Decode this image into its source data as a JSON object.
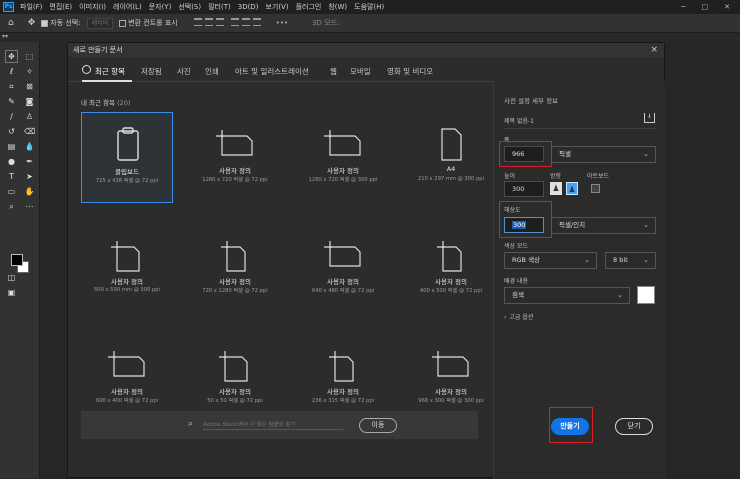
{
  "menubar": {
    "logo": "Ps",
    "items": [
      "파일(F)",
      "편집(E)",
      "이미지(I)",
      "레이어(L)",
      "문자(Y)",
      "선택(S)",
      "필터(T)",
      "3D(D)",
      "보기(V)",
      "플러그인",
      "창(W)",
      "도움말(H)"
    ]
  },
  "options": {
    "auto_select": "자동 선택:",
    "layer_value": "레이어",
    "transform": "변환 컨트롤 표시",
    "mode_3d": "3D 모드:"
  },
  "doc_strip": {
    "text": "▾▾"
  },
  "dialog": {
    "title": "새로 만들기 문서",
    "close": "×",
    "tabs": [
      "최근 항목",
      "저장됨",
      "사진",
      "인쇄",
      "아트 및 일러스트레이션",
      "웹",
      "모바일",
      "영화 및 비디오"
    ],
    "recent_label": "내 최근 항목",
    "recent_count": "(20)",
    "presets": [
      {
        "name": "클립보드",
        "size": "725 x 438 픽셀 @ 72 ppi",
        "icon": "clipboard-icon",
        "selected": true
      },
      {
        "name": "사용자 정의",
        "size": "1280 x 720 픽셀 @ 72 ppi",
        "icon": "custom-landscape-icon"
      },
      {
        "name": "사용자 정의",
        "size": "1280 x 720 픽셀 @ 300 ppi",
        "icon": "custom-landscape-icon"
      },
      {
        "name": "A4",
        "size": "210 x 297 mm @ 300 ppi",
        "icon": "document-icon"
      },
      {
        "name": "사용자 정의",
        "size": "500 x 500 mm @ 300 ppi",
        "icon": "custom-square-icon"
      },
      {
        "name": "사용자 정의",
        "size": "720 x 1280 픽셀 @ 72 ppi",
        "icon": "custom-portrait-icon"
      },
      {
        "name": "사용자 정의",
        "size": "640 x 480 픽셀 @ 72 ppi",
        "icon": "custom-landscape-icon"
      },
      {
        "name": "사용자 정의",
        "size": "400 x 500 픽셀 @ 72 ppi",
        "icon": "custom-portrait-icon"
      },
      {
        "name": "사용자 정의",
        "size": "600 x 400 픽셀 @ 72 ppi",
        "icon": "custom-landscape-icon"
      },
      {
        "name": "사용자 정의",
        "size": "50 x 50 픽셀 @ 72 ppi",
        "icon": "custom-square-icon"
      },
      {
        "name": "사용자 정의",
        "size": "236 x 315 픽셀 @ 72 ppi",
        "icon": "custom-portrait-icon"
      },
      {
        "name": "사용자 정의",
        "size": "966 x 300 픽셀 @ 300 ppi",
        "icon": "custom-landscape-icon"
      }
    ],
    "search": {
      "placeholder": "Adobe Stock에서 더 많은 템플릿 찾기",
      "go_label": "이동"
    },
    "details": {
      "section_title": "사전 설정 세부 정보",
      "doc_name": "제목 없음-1",
      "width_label": "폭",
      "width_value": "966",
      "width_unit": "픽셀",
      "height_label": "높이",
      "height_value": "300",
      "orientation_label": "방향",
      "artboard_label": "아트보드",
      "resolution_label": "해상도",
      "resolution_value": "300",
      "resolution_unit": "픽셀/인치",
      "color_mode_label": "색상 모드",
      "color_mode_value": "RGB 색상",
      "bit_depth": "8 bit",
      "background_label": "배경 내용",
      "background_value": "흰색",
      "advanced_label": "고급 옵션"
    },
    "create_label": "만들기",
    "close_label": "닫기"
  },
  "colors": {
    "accent": "#1473e6",
    "highlight_red": "#d81f26",
    "selection": "#3b8ee8"
  }
}
